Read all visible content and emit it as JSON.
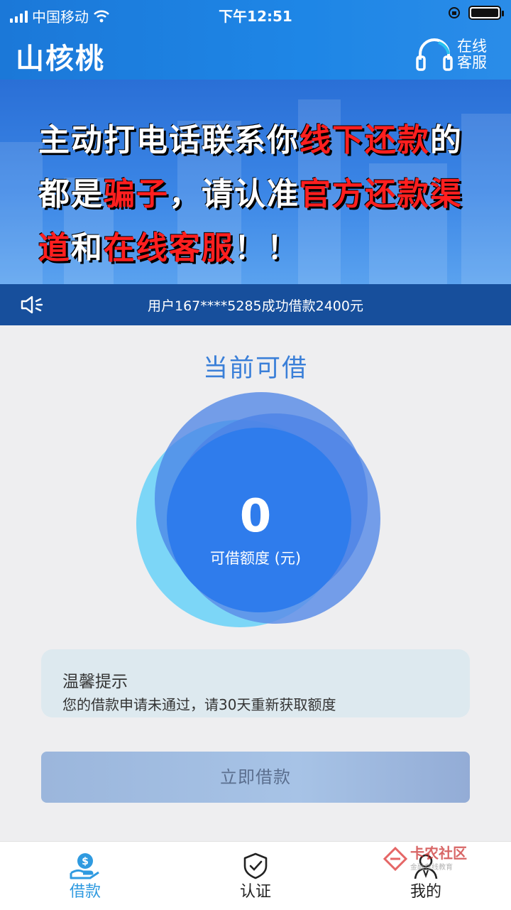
{
  "status_bar": {
    "carrier": "中国移动",
    "time": "下午12:51"
  },
  "header": {
    "app_title": "山核桃",
    "customer_service": "在线客服"
  },
  "banner": {
    "lines": [
      [
        {
          "t": "主动打电话联系你",
          "c": "w"
        },
        {
          "t": "线下还款",
          "c": "r"
        },
        {
          "t": "的",
          "c": "w"
        }
      ],
      [
        {
          "t": "都是",
          "c": "w"
        },
        {
          "t": "骗子",
          "c": "r"
        },
        {
          "t": "，请认准",
          "c": "w"
        },
        {
          "t": "官方还款渠",
          "c": "r"
        }
      ],
      [
        {
          "t": "道",
          "c": "r"
        },
        {
          "t": "和",
          "c": "w"
        },
        {
          "t": "在线客服",
          "c": "r"
        },
        {
          "t": "！！",
          "c": "w"
        }
      ]
    ]
  },
  "notice": {
    "text": "用户167****5285成功借款2400元"
  },
  "loan": {
    "title": "当前可借",
    "amount": "0",
    "amount_label": "可借额度 (元)"
  },
  "tip": {
    "title": "温馨提示",
    "body": "您的借款申请未通过，请30天重新获取额度"
  },
  "borrow_button": {
    "label": "立即借款"
  },
  "tabs": [
    {
      "label": "借款",
      "icon": "money-hand-icon",
      "active": true
    },
    {
      "label": "认证",
      "icon": "shield-check-icon",
      "active": false
    },
    {
      "label": "我的",
      "icon": "person-icon",
      "active": false
    }
  ],
  "watermark": {
    "text": "卡农社区",
    "sub": "金融在线教育"
  },
  "colors": {
    "header": "#1b78d8",
    "title_blue": "#3a7fd8",
    "notice_bg": "#174f9c",
    "tab_active": "#2f9ae0",
    "warning_red": "#ff1f1f"
  }
}
